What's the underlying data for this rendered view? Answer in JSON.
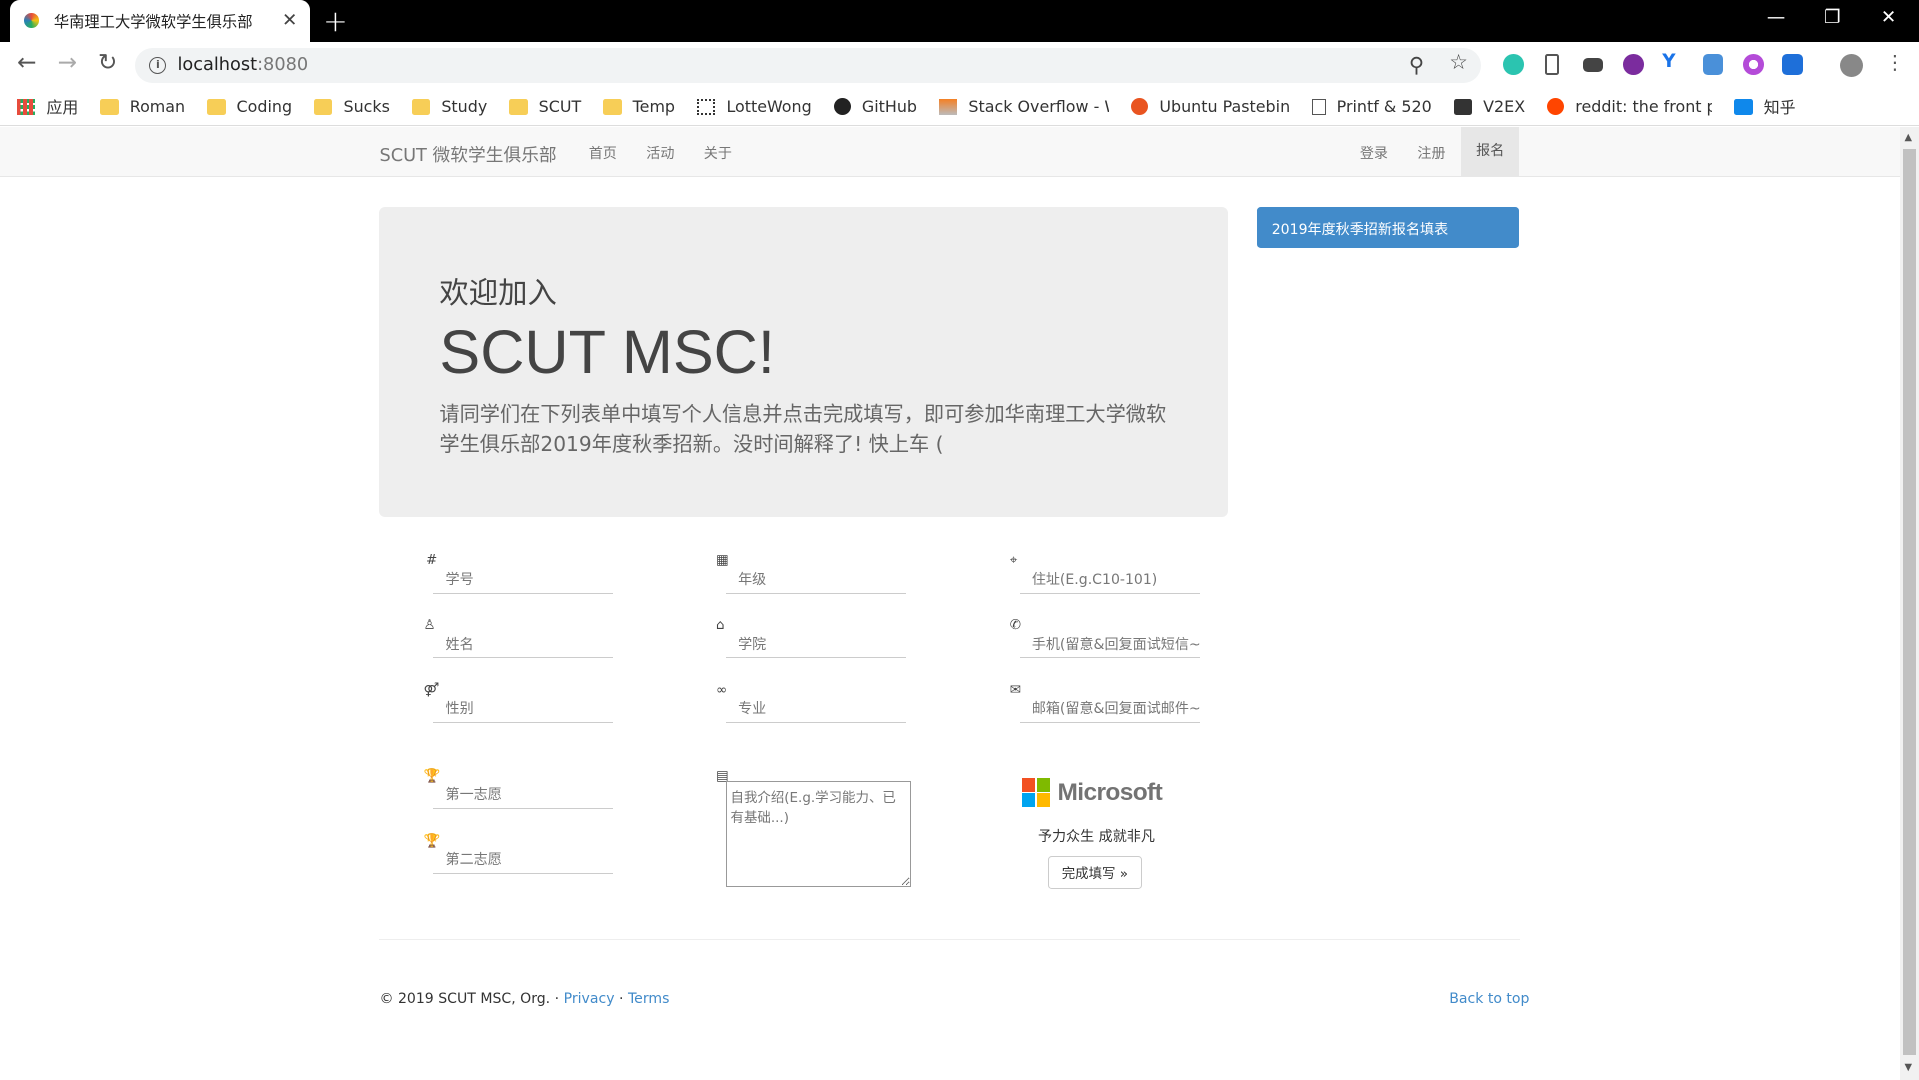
{
  "browser": {
    "tab_title": "华南理工大学微软学生俱乐部",
    "tab_close": "✕",
    "new_tab": "+",
    "window_controls": {
      "minimize": "—",
      "maximize": "❐",
      "close": "✕"
    },
    "url_host": "localhost",
    "url_port": ":8080",
    "nav": {
      "back": "←",
      "forward": "→",
      "reload": "↻"
    },
    "bookmarks": [
      {
        "label": "应用",
        "icon": "apps-grid-icon"
      },
      {
        "label": "Roman",
        "icon": "folder-icon"
      },
      {
        "label": "Coding",
        "icon": "folder-icon"
      },
      {
        "label": "Sucks",
        "icon": "folder-icon"
      },
      {
        "label": "Study",
        "icon": "folder-icon"
      },
      {
        "label": "SCUT",
        "icon": "folder-icon"
      },
      {
        "label": "Temp",
        "icon": "folder-icon"
      },
      {
        "label": "LotteWong",
        "icon": "qr-icon"
      },
      {
        "label": "GitHub",
        "icon": "github-icon"
      },
      {
        "label": "Stack Overflow - W",
        "icon": "stackoverflow-icon"
      },
      {
        "label": "Ubuntu Pastebin",
        "icon": "ubuntu-icon"
      },
      {
        "label": "Printf & 520",
        "icon": "page-icon"
      },
      {
        "label": "V2EX",
        "icon": "v2ex-icon"
      },
      {
        "label": "reddit: the front pa",
        "icon": "reddit-icon"
      },
      {
        "label": "知乎",
        "icon": "zhihu-icon"
      }
    ]
  },
  "navbar": {
    "brand": "SCUT 微软学生俱乐部",
    "links": [
      "首页",
      "活动",
      "关于"
    ],
    "right_links": [
      "登录",
      "注册",
      "报名"
    ]
  },
  "jumbotron": {
    "welcome": "欢迎加入",
    "headline": "SCUT MSC!",
    "lead": "请同学们在下列表单中填写个人信息并点击完成填写，即可参加华南理工大学微软学生俱乐部2019年度秋季招新。没时间解释了! 快上车 ("
  },
  "side_button": "2019年度秋季招新报名填表",
  "form": {
    "student_id": "学号",
    "name": "姓名",
    "gender": "性别",
    "grade": "年级",
    "college": "学院",
    "major": "专业",
    "address": "住址(E.g.C10-101)",
    "phone": "手机(留意&回复面试短信~)",
    "email": "邮箱(留意&回复面试邮件~)",
    "first_choice": "第一志愿",
    "second_choice": "第二志愿",
    "intro": "自我介绍(E.g.学习能力、已有基础...)"
  },
  "brand_block": {
    "logo_text": "Microsoft",
    "logo_colors": [
      "#f25022",
      "#7fba00",
      "#00a4ef",
      "#ffb900"
    ],
    "slogan": "予力众生 成就非凡",
    "submit": "完成填写 »"
  },
  "footer": {
    "copyright": "© 2019 SCUT MSC, Org.",
    "sep": "·",
    "privacy": "Privacy",
    "terms": "Terms",
    "back_to_top": "Back to top"
  },
  "colors": {
    "accent": "#428bca",
    "jumbotron_bg": "#eeeeee",
    "navbar_bg": "#f8f8f8"
  }
}
